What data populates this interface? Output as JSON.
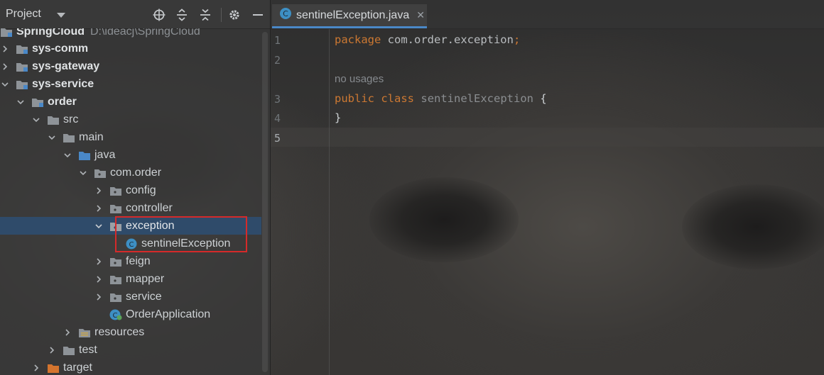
{
  "project_panel": {
    "title": "Project",
    "tree": [
      {
        "label": "SpringCloud",
        "hint": "D:\\ideacj\\SpringCloud",
        "bold": true
      },
      {
        "label": "sys-comm",
        "bold": true
      },
      {
        "label": "sys-gateway",
        "bold": true
      },
      {
        "label": "sys-service",
        "bold": true
      },
      {
        "label": "order",
        "bold": true
      },
      {
        "label": "src"
      },
      {
        "label": "main"
      },
      {
        "label": "java"
      },
      {
        "label": "com.order"
      },
      {
        "label": "config"
      },
      {
        "label": "controller"
      },
      {
        "label": "exception"
      },
      {
        "label": "sentinelException"
      },
      {
        "label": "feign"
      },
      {
        "label": "mapper"
      },
      {
        "label": "service"
      },
      {
        "label": "OrderApplication"
      },
      {
        "label": "resources"
      },
      {
        "label": "test"
      },
      {
        "label": "target"
      }
    ]
  },
  "editor": {
    "tab_label": "sentinelException.java",
    "line_numbers": [
      "1",
      "2",
      "3",
      "4",
      "5"
    ],
    "code": {
      "line1_kw": "package",
      "line1_pkg": "com.order.exception",
      "line1_semi": ";",
      "usage_hint": "no usages",
      "line3_kw1": "public",
      "line3_kw2": "class",
      "line3_name": "sentinelException",
      "line3_brace": "{",
      "line4_brace": "}"
    }
  },
  "colors": {
    "selection": "#2f4b6a",
    "highlight_box": "#d52a2a",
    "keyword": "#cc7832",
    "tab_underline": "#4a88c7"
  }
}
